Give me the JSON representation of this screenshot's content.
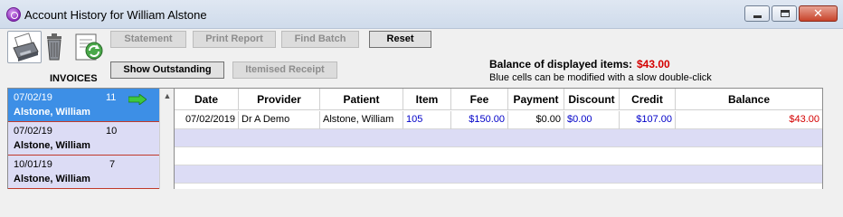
{
  "window": {
    "title": "Account History for William Alstone",
    "minimize_label": "",
    "maximize_label": "",
    "close_label": "✕"
  },
  "toolbar": {
    "statement": "Statement",
    "print_report": "Print Report",
    "find_batch": "Find Batch",
    "reset": "Reset",
    "show_outstanding": "Show Outstanding",
    "itemised_receipt": "Itemised Receipt"
  },
  "invoices_label": "INVOICES",
  "balance": {
    "label": "Balance of displayed items:",
    "value": "$43.00",
    "value_color": "#d40000",
    "hint": "Blue cells can be modified with a slow double-click"
  },
  "invoices": [
    {
      "date": "07/02/19",
      "count": "11",
      "name": "Alstone, William",
      "selected": true
    },
    {
      "date": "07/02/19",
      "count": "10",
      "name": "Alstone, William",
      "selected": false
    },
    {
      "date": "10/01/19",
      "count": "7",
      "name": "Alstone, William",
      "selected": false
    }
  ],
  "grid": {
    "columns": [
      "Date",
      "Provider",
      "Patient",
      "Item",
      "Fee",
      "Payment",
      "Discount",
      "Credit",
      "Balance"
    ],
    "rows": [
      {
        "date": "07/02/2019",
        "provider": "Dr A Demo",
        "patient": "Alstone, William",
        "item": "105",
        "fee": "$150.00",
        "payment": "$0.00",
        "discount": "$0.00",
        "credit": "$107.00",
        "balance": "$43.00"
      }
    ]
  },
  "colors": {
    "selected_row": "#3d8fe6",
    "alt_row": "#dcdcf5",
    "editable_text": "#0000c8",
    "balance_text": "#d40000"
  }
}
